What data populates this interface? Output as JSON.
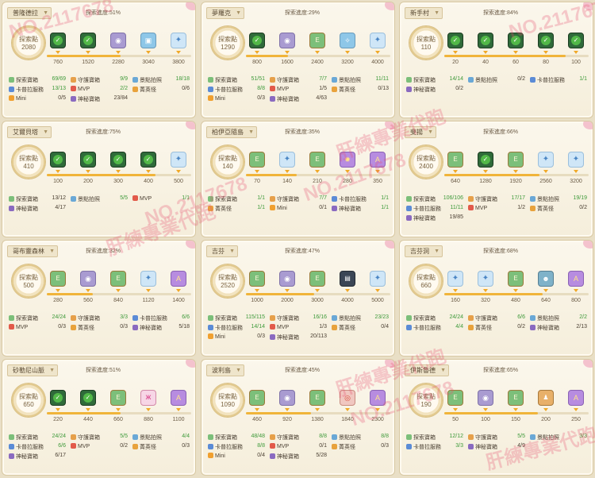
{
  "panels": [
    {
      "name": "普隆德拉",
      "rate": "探索進度:51%",
      "points_label": "探索點",
      "points": "2080",
      "progress": 0.51,
      "tiers": [
        {
          "value": "760",
          "icon": "done",
          "glyph": "✓"
        },
        {
          "value": "1520",
          "icon": "done",
          "glyph": "✓"
        },
        {
          "value": "2280",
          "icon": "rock",
          "glyph": "◉"
        },
        {
          "value": "3040",
          "icon": "pic",
          "glyph": "▣"
        },
        {
          "value": "3800",
          "icon": "blue",
          "glyph": "✦"
        }
      ],
      "stats": [
        {
          "label": "探索寶箱",
          "value": "69/69",
          "color": "#7cbf7a"
        },
        {
          "label": "守護寶箱",
          "value": "9/9",
          "color": "#e6a04a"
        },
        {
          "label": "景點拍照",
          "value": "18/18",
          "color": "#6aa8d6"
        },
        {
          "label": "卡普拉服務",
          "value": "13/13",
          "color": "#5b8bd6"
        },
        {
          "label": "MVP",
          "value": "2/2",
          "color": "#e25a4a"
        },
        {
          "label": "菁英怪",
          "value": "0/6",
          "color": "#e8a23c"
        },
        {
          "label": "Mini",
          "value": "0/5",
          "color": "#f0a030"
        },
        {
          "label": "神秘寶箱",
          "value": "23/84",
          "color": "#8a6ac0"
        }
      ]
    },
    {
      "name": "夢羅克",
      "rate": "探索進度:29%",
      "points_label": "探索點",
      "points": "1290",
      "progress": 0.29,
      "tiers": [
        {
          "value": "800",
          "icon": "done",
          "glyph": "✓"
        },
        {
          "value": "1600",
          "icon": "rock",
          "glyph": "◉"
        },
        {
          "value": "2400",
          "icon": "chest",
          "glyph": "E"
        },
        {
          "value": "3200",
          "icon": "pic",
          "glyph": "✧"
        },
        {
          "value": "4000",
          "icon": "blue",
          "glyph": "✦"
        }
      ],
      "stats": [
        {
          "label": "探索寶箱",
          "value": "51/51",
          "color": "#7cbf7a"
        },
        {
          "label": "守護寶箱",
          "value": "7/7",
          "color": "#e6a04a"
        },
        {
          "label": "景點拍照",
          "value": "11/11",
          "color": "#6aa8d6"
        },
        {
          "label": "卡普拉服務",
          "value": "8/8",
          "color": "#5b8bd6"
        },
        {
          "label": "MVP",
          "value": "1/5",
          "color": "#e25a4a"
        },
        {
          "label": "菁英怪",
          "value": "0/13",
          "color": "#e8a23c"
        },
        {
          "label": "Mini",
          "value": "0/3",
          "color": "#f0a030"
        },
        {
          "label": "神秘寶箱",
          "value": "4/63",
          "color": "#8a6ac0"
        }
      ]
    },
    {
      "name": "新手村",
      "rate": "探索進度:84%",
      "points_label": "探索點",
      "points": "110",
      "progress": 0.84,
      "tiers": [
        {
          "value": "20",
          "icon": "done",
          "glyph": "✓"
        },
        {
          "value": "40",
          "icon": "done",
          "glyph": "✓"
        },
        {
          "value": "60",
          "icon": "done",
          "glyph": "✓"
        },
        {
          "value": "80",
          "icon": "done",
          "glyph": "✓"
        },
        {
          "value": "100",
          "icon": "done",
          "glyph": "✓"
        }
      ],
      "stats": [
        {
          "label": "探索寶箱",
          "value": "14/14",
          "color": "#7cbf7a"
        },
        {
          "label": "景點拍照",
          "value": "0/2",
          "color": "#6aa8d6"
        },
        {
          "label": "卡普拉服務",
          "value": "1/1",
          "color": "#5b8bd6"
        },
        {
          "label": "神秘寶箱",
          "value": "0/2",
          "color": "#8a6ac0"
        }
      ]
    },
    {
      "name": "艾爾貝塔",
      "rate": "探索進度:75%",
      "points_label": "探索點",
      "points": "410",
      "progress": 0.75,
      "tiers": [
        {
          "value": "100",
          "icon": "done",
          "glyph": "✓"
        },
        {
          "value": "200",
          "icon": "done",
          "glyph": "✓"
        },
        {
          "value": "300",
          "icon": "done",
          "glyph": "✓"
        },
        {
          "value": "400",
          "icon": "done",
          "glyph": "✓"
        },
        {
          "value": "500",
          "icon": "blue",
          "glyph": "✦"
        }
      ],
      "stats": [
        {
          "label": "探索寶箱",
          "value": "13/12",
          "color": "#7cbf7a"
        },
        {
          "label": "景點拍照",
          "value": "5/5",
          "color": "#6aa8d6"
        },
        {
          "label": "MVP",
          "value": "1/1",
          "color": "#e25a4a"
        },
        {
          "label": "神秘寶箱",
          "value": "4/17",
          "color": "#8a6ac0"
        }
      ]
    },
    {
      "name": "柏伊亞隨島",
      "rate": "探索進度:35%",
      "points_label": "探索點",
      "points": "140",
      "progress": 0.35,
      "tiers": [
        {
          "value": "70",
          "icon": "chest",
          "glyph": "E"
        },
        {
          "value": "140",
          "icon": "blue",
          "glyph": "✦"
        },
        {
          "value": "210",
          "icon": "chest",
          "glyph": "E"
        },
        {
          "value": "280",
          "icon": "purple",
          "glyph": "✹"
        },
        {
          "value": "350",
          "icon": "purple",
          "glyph": "A"
        }
      ],
      "stats": [
        {
          "label": "探索寶箱",
          "value": "1/1",
          "color": "#7cbf7a"
        },
        {
          "label": "守護寶箱",
          "value": "7/7",
          "color": "#e6a04a"
        },
        {
          "label": "卡普拉服務",
          "value": "1/1",
          "color": "#5b8bd6"
        },
        {
          "label": "菁英怪",
          "value": "1/1",
          "color": "#e8a23c"
        },
        {
          "label": "Mini",
          "value": "0/1",
          "color": "#f0a030"
        },
        {
          "label": "神秘寶箱",
          "value": "1/1",
          "color": "#8a6ac0"
        }
      ]
    },
    {
      "name": "斐揚",
      "rate": "探索進度:66%",
      "points_label": "探索點",
      "points": "2400",
      "progress": 0.66,
      "tiers": [
        {
          "value": "640",
          "icon": "chest",
          "glyph": "E"
        },
        {
          "value": "1280",
          "icon": "done",
          "glyph": "✓"
        },
        {
          "value": "1920",
          "icon": "chest",
          "glyph": "E"
        },
        {
          "value": "2560",
          "icon": "blue",
          "glyph": "✦"
        },
        {
          "value": "3200",
          "icon": "blue",
          "glyph": "✦"
        }
      ],
      "stats": [
        {
          "label": "探索寶箱",
          "value": "106/106",
          "color": "#7cbf7a"
        },
        {
          "label": "守護寶箱",
          "value": "17/17",
          "color": "#e6a04a"
        },
        {
          "label": "景點拍照",
          "value": "19/19",
          "color": "#6aa8d6"
        },
        {
          "label": "卡普拉服務",
          "value": "11/11",
          "color": "#5b8bd6"
        },
        {
          "label": "MVP",
          "value": "1/2",
          "color": "#e25a4a"
        },
        {
          "label": "菁英怪",
          "value": "0/2",
          "color": "#e8a23c"
        },
        {
          "label": "神秘寶箱",
          "value": "19/85",
          "color": "#8a6ac0"
        }
      ]
    },
    {
      "name": "哥布靈森林",
      "rate": "探索進度:32%",
      "points_label": "探索點",
      "points": "500",
      "progress": 0.32,
      "tiers": [
        {
          "value": "280",
          "icon": "chest",
          "glyph": "E"
        },
        {
          "value": "560",
          "icon": "rock",
          "glyph": "◉"
        },
        {
          "value": "840",
          "icon": "chest",
          "glyph": "E"
        },
        {
          "value": "1120",
          "icon": "blue",
          "glyph": "✦"
        },
        {
          "value": "1400",
          "icon": "purple",
          "glyph": "A"
        }
      ],
      "stats": [
        {
          "label": "探索寶箱",
          "value": "24/24",
          "color": "#7cbf7a"
        },
        {
          "label": "守護寶箱",
          "value": "3/3",
          "color": "#e6a04a"
        },
        {
          "label": "卡普拉服務",
          "value": "6/6",
          "color": "#5b8bd6"
        },
        {
          "label": "MVP",
          "value": "0/3",
          "color": "#e25a4a"
        },
        {
          "label": "菁英怪",
          "value": "0/3",
          "color": "#e8a23c"
        },
        {
          "label": "神秘寶箱",
          "value": "5/18",
          "color": "#8a6ac0"
        }
      ]
    },
    {
      "name": "吉芬",
      "rate": "探索進度:47%",
      "points_label": "探索點",
      "points": "2520",
      "progress": 0.47,
      "tiers": [
        {
          "value": "1000",
          "icon": "chest",
          "glyph": "E"
        },
        {
          "value": "2000",
          "icon": "rock",
          "glyph": "◉"
        },
        {
          "value": "3000",
          "icon": "chest",
          "glyph": "E"
        },
        {
          "value": "4000",
          "icon": "note",
          "glyph": "▤"
        },
        {
          "value": "5000",
          "icon": "blue",
          "glyph": "✦"
        }
      ],
      "stats": [
        {
          "label": "探索寶箱",
          "value": "115/115",
          "color": "#7cbf7a"
        },
        {
          "label": "守護寶箱",
          "value": "16/16",
          "color": "#e6a04a"
        },
        {
          "label": "景點拍照",
          "value": "23/23",
          "color": "#6aa8d6"
        },
        {
          "label": "卡普拉服務",
          "value": "14/14",
          "color": "#5b8bd6"
        },
        {
          "label": "MVP",
          "value": "1/3",
          "color": "#e25a4a"
        },
        {
          "label": "菁英怪",
          "value": "0/4",
          "color": "#e8a23c"
        },
        {
          "label": "Mini",
          "value": "0/3",
          "color": "#f0a030"
        },
        {
          "label": "神秘寶箱",
          "value": "20/113",
          "color": "#8a6ac0"
        }
      ]
    },
    {
      "name": "吉芬洞",
      "rate": "探索進度:68%",
      "points_label": "探索點",
      "points": "660",
      "progress": 0.68,
      "tiers": [
        {
          "value": "160",
          "icon": "blue",
          "glyph": "✦"
        },
        {
          "value": "320",
          "icon": "blue",
          "glyph": "✦"
        },
        {
          "value": "480",
          "icon": "chest",
          "glyph": "E"
        },
        {
          "value": "640",
          "icon": "frog",
          "glyph": "☻"
        },
        {
          "value": "800",
          "icon": "purple",
          "glyph": "A"
        }
      ],
      "stats": [
        {
          "label": "探索寶箱",
          "value": "24/24",
          "color": "#7cbf7a"
        },
        {
          "label": "守護寶箱",
          "value": "6/6",
          "color": "#e6a04a"
        },
        {
          "label": "景點拍照",
          "value": "2/2",
          "color": "#6aa8d6"
        },
        {
          "label": "卡普拉服務",
          "value": "4/4",
          "color": "#5b8bd6"
        },
        {
          "label": "菁英怪",
          "value": "0/2",
          "color": "#e8a23c"
        },
        {
          "label": "神秘寶箱",
          "value": "2/13",
          "color": "#8a6ac0"
        }
      ]
    },
    {
      "name": "砂勒尼山脈",
      "rate": "探索進度:51%",
      "points_label": "探索點",
      "points": "650",
      "progress": 0.51,
      "tiers": [
        {
          "value": "220",
          "icon": "done",
          "glyph": "✓"
        },
        {
          "value": "440",
          "icon": "done",
          "glyph": "✓"
        },
        {
          "value": "660",
          "icon": "chest",
          "glyph": "E"
        },
        {
          "value": "880",
          "icon": "bfly",
          "glyph": "ж"
        },
        {
          "value": "1100",
          "icon": "purple",
          "glyph": "A"
        }
      ],
      "stats": [
        {
          "label": "探索寶箱",
          "value": "24/24",
          "color": "#7cbf7a"
        },
        {
          "label": "守護寶箱",
          "value": "5/5",
          "color": "#e6a04a"
        },
        {
          "label": "景點拍照",
          "value": "4/4",
          "color": "#6aa8d6"
        },
        {
          "label": "卡普拉服務",
          "value": "6/6",
          "color": "#5b8bd6"
        },
        {
          "label": "MVP",
          "value": "0/2",
          "color": "#e25a4a"
        },
        {
          "label": "菁英怪",
          "value": "0/3",
          "color": "#e8a23c"
        },
        {
          "label": "神秘寶箱",
          "value": "6/17",
          "color": "#8a6ac0"
        }
      ]
    },
    {
      "name": "波利島",
      "rate": "探索進度:45%",
      "points_label": "探索點",
      "points": "1090",
      "progress": 0.45,
      "tiers": [
        {
          "value": "460",
          "icon": "chest",
          "glyph": "E"
        },
        {
          "value": "920",
          "icon": "rock",
          "glyph": "◉"
        },
        {
          "value": "1380",
          "icon": "chest",
          "glyph": "E"
        },
        {
          "value": "1840",
          "icon": "fire",
          "glyph": "◎"
        },
        {
          "value": "2300",
          "icon": "purple",
          "glyph": "A"
        }
      ],
      "stats": [
        {
          "label": "探索寶箱",
          "value": "48/48",
          "color": "#7cbf7a"
        },
        {
          "label": "守護寶箱",
          "value": "8/8",
          "color": "#e6a04a"
        },
        {
          "label": "景點拍照",
          "value": "8/8",
          "color": "#6aa8d6"
        },
        {
          "label": "卡普拉服務",
          "value": "8/8",
          "color": "#5b8bd6"
        },
        {
          "label": "MVP",
          "value": "0/1",
          "color": "#e25a4a"
        },
        {
          "label": "菁英怪",
          "value": "0/3",
          "color": "#e8a23c"
        },
        {
          "label": "Mini",
          "value": "0/4",
          "color": "#f0a030"
        },
        {
          "label": "神秘寶箱",
          "value": "5/28",
          "color": "#8a6ac0"
        }
      ]
    },
    {
      "name": "伊斯魯德",
      "rate": "探索進度:65%",
      "points_label": "探索點",
      "points": "190",
      "progress": 0.65,
      "tiers": [
        {
          "value": "50",
          "icon": "chest",
          "glyph": "E"
        },
        {
          "value": "100",
          "icon": "rock",
          "glyph": "◉"
        },
        {
          "value": "150",
          "icon": "chest",
          "glyph": "E"
        },
        {
          "value": "200",
          "icon": "card",
          "glyph": "♟"
        },
        {
          "value": "250",
          "icon": "purple",
          "glyph": "A"
        }
      ],
      "stats": [
        {
          "label": "探索寶箱",
          "value": "12/12",
          "color": "#7cbf7a"
        },
        {
          "label": "守護寶箱",
          "value": "5/5",
          "color": "#e6a04a"
        },
        {
          "label": "景點拍照",
          "value": "3/3",
          "color": "#6aa8d6"
        },
        {
          "label": "卡普拉服務",
          "value": "3/3",
          "color": "#5b8bd6"
        },
        {
          "label": "神秘寶箱",
          "value": "4/9",
          "color": "#8a6ac0"
        }
      ]
    }
  ],
  "watermarks": [
    "肝練專業代跑",
    "NO.2117678"
  ]
}
